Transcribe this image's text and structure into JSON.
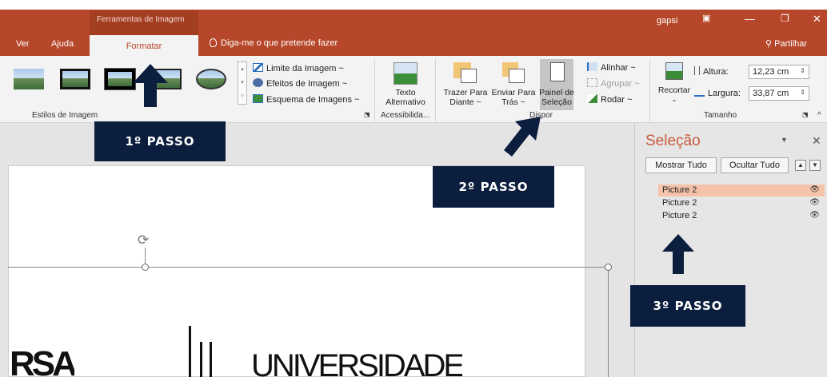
{
  "title_bar": {
    "tools_header": "Ferramentas de Imagem",
    "user": "gapsi",
    "share": "Partilhar"
  },
  "tabs": {
    "ver": "Ver",
    "ajuda": "Ajuda",
    "formatar": "Formatar",
    "tell_me": "Diga-me o que pretende fazer"
  },
  "ribbon": {
    "picture_styles": {
      "label": "Estilos de Imagem",
      "options": [
        "Limite da Imagem ~",
        "Efeitos de Imagem ~",
        "Esquema de Imagens ~"
      ]
    },
    "accessibility": {
      "label": "Acessibilida...",
      "alt_text_line1": "Texto",
      "alt_text_line2": "Alternativo"
    },
    "arrange": {
      "label": "Dispor",
      "bring_forward_line1": "Trazer Para",
      "bring_forward_line2": "Diante ~",
      "send_backward_line1": "Enviar Para",
      "send_backward_line2": "Trás ~",
      "selection_pane_line1": "Painel de",
      "selection_pane_line2": "Seleção",
      "align": "Alinhar ~",
      "group": "Agrupar ~",
      "rotate": "Rodar ~"
    },
    "size": {
      "label": "Tamanho",
      "crop": "Recortar",
      "height_label": "Altura:",
      "height_value": "12,23 cm",
      "width_label": "Largura:",
      "width_value": "33,87 cm"
    }
  },
  "selection_pane": {
    "title": "Seleção",
    "show_all": "Mostrar Tudo",
    "hide_all": "Ocultar Tudo",
    "items": [
      {
        "label": "Picture 2",
        "selected": true
      },
      {
        "label": "Picture 2",
        "selected": false
      },
      {
        "label": "Picture 2",
        "selected": false
      }
    ]
  },
  "slide": {
    "logo_left": "RSA",
    "logo_right": "UNIVERSIDADE"
  },
  "callouts": {
    "step1": "1º PASSO",
    "step2": "2º PASSO",
    "step3": "3º PASSO"
  },
  "colors": {
    "accent": "#b7472a",
    "callout": "#0c1e3e",
    "selected_item": "#f5c3a9"
  }
}
